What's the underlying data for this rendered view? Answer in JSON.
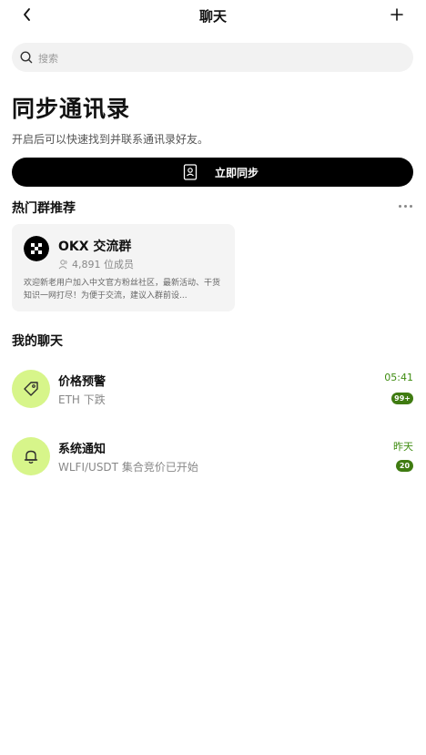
{
  "header": {
    "title": "聊天",
    "back_icon": "chevron-left-icon",
    "add_icon": "plus-icon"
  },
  "search": {
    "placeholder": "搜索",
    "icon": "search-icon"
  },
  "contacts": {
    "title": "同步通讯录",
    "subtitle": "开启后可以快速找到并联系通讯录好友。",
    "button_label": "立即同步",
    "button_icon": "contact-book-icon"
  },
  "hot_groups": {
    "title": "热门群推荐",
    "more_icon": "more-horizontal-icon",
    "items": [
      {
        "name": "OKX 交流群",
        "members": "4,891 位成员",
        "description": "欢迎新老用户加入中文官方粉丝社区，最新活动、干货知识一网打尽！为便于交流，建议入群前设..."
      }
    ]
  },
  "my_chats": {
    "title": "我的聊天",
    "items": [
      {
        "name": "价格预警",
        "message": "ETH 下跌",
        "time": "05:41",
        "badge": "99+",
        "icon": "price-tag-icon"
      },
      {
        "name": "系统通知",
        "message": "WLFI/USDT 集合竞价已开始",
        "time": "昨天",
        "badge": "20",
        "icon": "bell-icon"
      }
    ]
  },
  "colors": {
    "accent_green": "#3f8c11",
    "avatar_bg": "#d7f58a",
    "primary_button": "#000000"
  }
}
